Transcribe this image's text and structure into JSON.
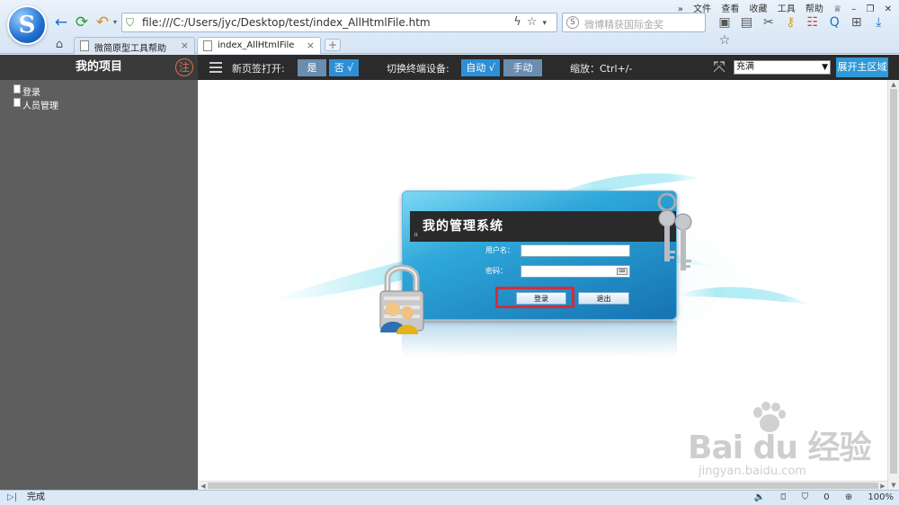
{
  "browser": {
    "address_url": "file:///C:/Users/jyc/Desktop/test/index_AllHtmlFile.htm",
    "search_placeholder": "微博精获国际金奖",
    "menu": [
      "文件",
      "查看",
      "收藏",
      "工具",
      "帮助"
    ],
    "tabs": [
      {
        "title": "微简原型工具帮助"
      },
      {
        "title": "index_AllHtmlFile"
      }
    ],
    "new_tab": "+",
    "status_text": "完成",
    "status_right": {
      "count": "0",
      "zoom": "100%"
    }
  },
  "toolbar": {
    "project_title": "我的项目",
    "badge": "注",
    "new_tab_label": "新页签打开:",
    "yes": "是",
    "no": "否 √",
    "device_label": "切换终端设备:",
    "auto": "自动 √",
    "manual": "手动",
    "zoom_label": "缩放：Ctrl+/-",
    "fit_select": "充满",
    "expand_btn": "展开主区域"
  },
  "sidebar": {
    "items": [
      {
        "label": "登录"
      },
      {
        "label": "人员管理"
      }
    ]
  },
  "login": {
    "title": "我的管理系统",
    "username_label": "用户名：",
    "password_label": "密码：",
    "login_btn": "登录",
    "exit_btn": "退出"
  },
  "watermark": {
    "main": "Bai du 经验",
    "sub": "jingyan.baidu.com"
  },
  "colors": {
    "accent_blue": "#2f8fd6",
    "highlight_red": "#d42c3c",
    "sidebar_bg": "#5e5e5e",
    "topbar_bg": "#2b2b2b"
  }
}
